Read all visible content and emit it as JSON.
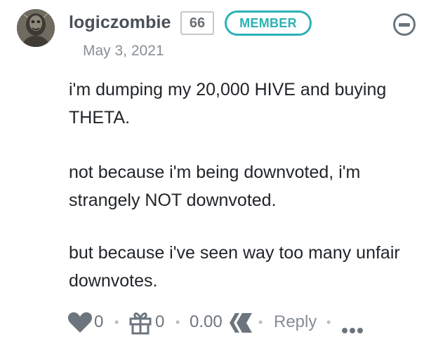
{
  "comment": {
    "author": "logiczombie",
    "reputation": "66",
    "badge": "MEMBER",
    "date": "May 3, 2021",
    "paragraphs": [
      "i'm dumping my 20,000 HIVE and buying THETA.",
      "not because i'm being downvoted, i'm strangely NOT downvoted.",
      "but because i've seen way too many unfair downvotes."
    ]
  },
  "footer": {
    "vote_count": "0",
    "gift_count": "0",
    "payout": "0.00",
    "reply_label": "Reply",
    "separator": "•"
  },
  "icons": {
    "avatar": "avatar",
    "collapse": "minus-circle-icon",
    "heart": "heart-icon",
    "gift": "gift-icon",
    "payout_currency": "hive-logo-icon",
    "more": "more-dots-icon"
  },
  "colors": {
    "author": "#495057",
    "badge": "#2bb1b5",
    "body_text": "#212529",
    "muted": "#8a8f94",
    "icon": "#6c757d"
  }
}
